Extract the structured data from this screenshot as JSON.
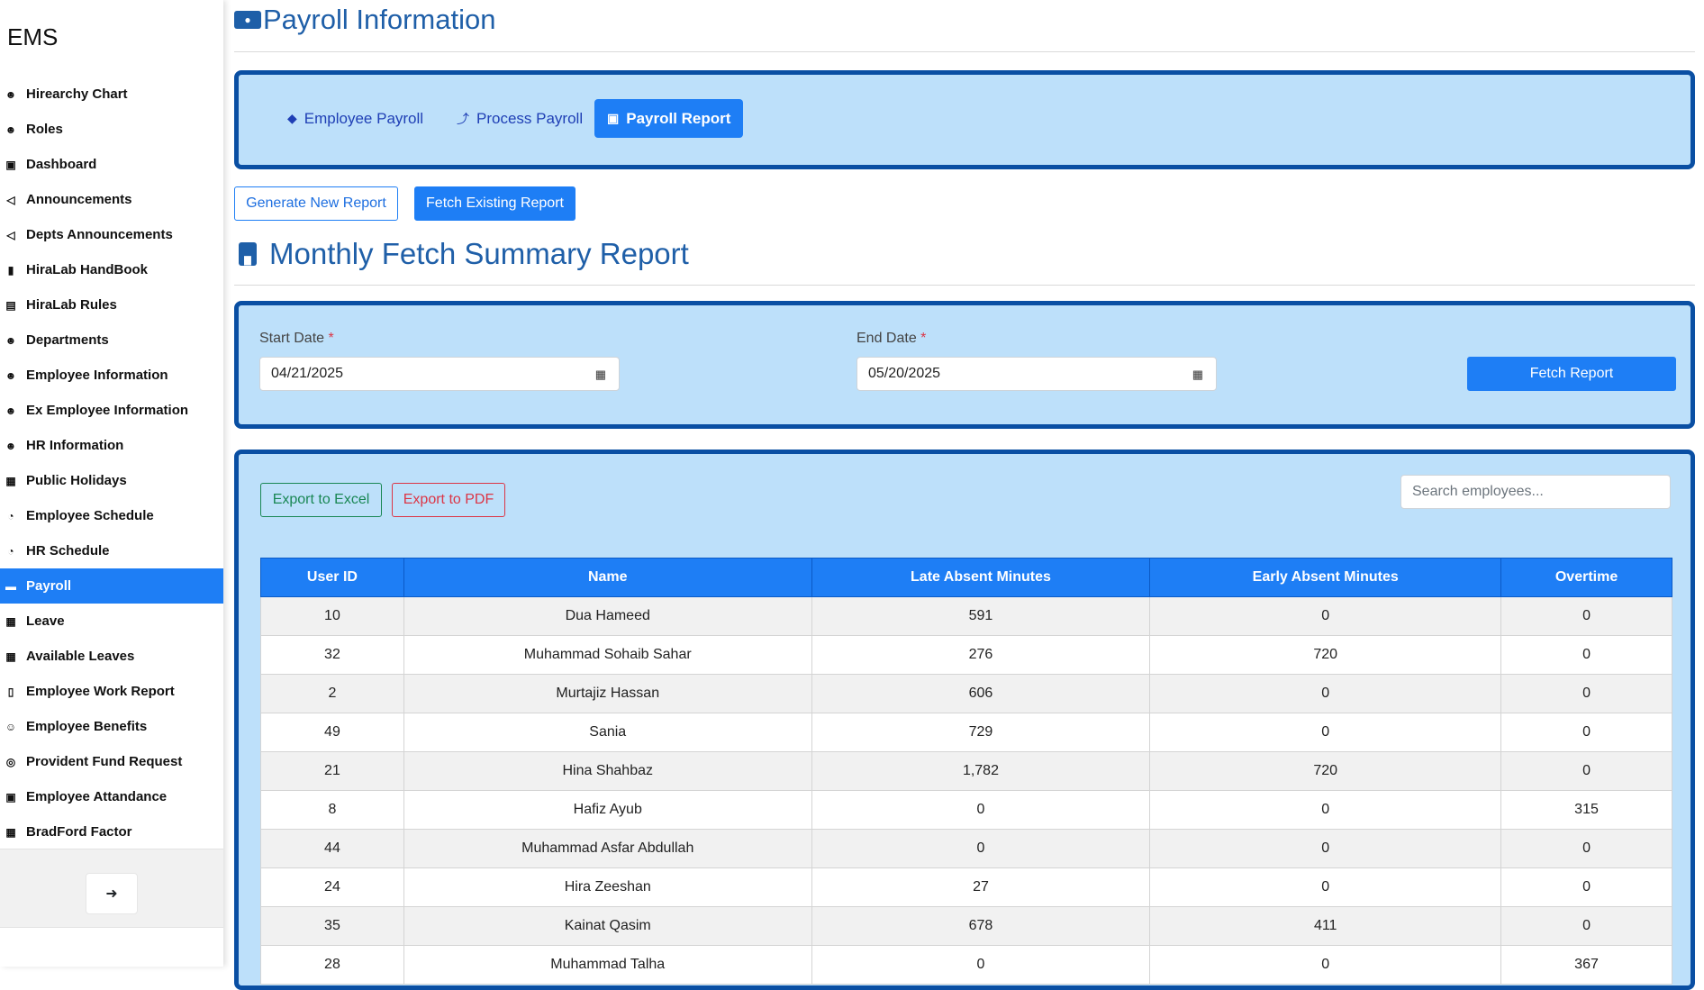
{
  "app": {
    "brand": "EMS"
  },
  "sidebar": {
    "items": [
      {
        "label": "Hirearchy Chart",
        "icon": "users-icon"
      },
      {
        "label": "Roles",
        "icon": "users-icon"
      },
      {
        "label": "Dashboard",
        "icon": "dashboard-icon"
      },
      {
        "label": "Announcements",
        "icon": "megaphone-icon"
      },
      {
        "label": "Depts Announcements",
        "icon": "megaphone-icon"
      },
      {
        "label": "HiraLab HandBook",
        "icon": "book-icon"
      },
      {
        "label": "HiraLab Rules",
        "icon": "rules-icon"
      },
      {
        "label": "Departments",
        "icon": "users-icon"
      },
      {
        "label": "Employee Information",
        "icon": "users-icon"
      },
      {
        "label": "Ex Employee Information",
        "icon": "users-icon"
      },
      {
        "label": "HR Information",
        "icon": "users-icon"
      },
      {
        "label": "Public Holidays",
        "icon": "calendar-icon"
      },
      {
        "label": "Employee Schedule",
        "icon": "clock-icon"
      },
      {
        "label": "HR Schedule",
        "icon": "clock-icon"
      },
      {
        "label": "Payroll",
        "icon": "money-icon"
      },
      {
        "label": "Leave",
        "icon": "calendar-icon"
      },
      {
        "label": "Available Leaves",
        "icon": "calendar-icon"
      },
      {
        "label": "Employee Work Report",
        "icon": "file-icon"
      },
      {
        "label": "Employee Benefits",
        "icon": "smile-icon"
      },
      {
        "label": "Provident Fund Request",
        "icon": "fund-icon"
      },
      {
        "label": "Employee Attandance",
        "icon": "id-card-icon"
      },
      {
        "label": "BradFord Factor",
        "icon": "calendar-icon"
      }
    ],
    "active": "Payroll"
  },
  "header": {
    "title": "Payroll Information"
  },
  "tabs": {
    "employee_payroll": "Employee Payroll",
    "process_payroll": "Process Payroll",
    "payroll_report": "Payroll Report"
  },
  "actions": {
    "generate": "Generate New Report",
    "fetch_existing": "Fetch Existing Report"
  },
  "section": {
    "title": "Monthly Fetch Summary Report"
  },
  "filters": {
    "start_label": "Start Date",
    "start_value": "04/21/2025",
    "end_label": "End Date",
    "end_value": "05/20/2025",
    "required_mark": "*",
    "fetch_button": "Fetch Report"
  },
  "export": {
    "excel": "Export to Excel",
    "pdf": "Export to PDF"
  },
  "search": {
    "placeholder": "Search employees..."
  },
  "table": {
    "headers": [
      "User ID",
      "Name",
      "Late Absent Minutes",
      "Early Absent Minutes",
      "Overtime"
    ],
    "rows": [
      [
        "10",
        "Dua Hameed",
        "591",
        "0",
        "0"
      ],
      [
        "32",
        "Muhammad Sohaib Sahar",
        "276",
        "720",
        "0"
      ],
      [
        "2",
        "Murtajiz Hassan",
        "606",
        "0",
        "0"
      ],
      [
        "49",
        "Sania",
        "729",
        "0",
        "0"
      ],
      [
        "21",
        "Hina Shahbaz",
        "1,782",
        "720",
        "0"
      ],
      [
        "8",
        "Hafiz Ayub",
        "0",
        "0",
        "315"
      ],
      [
        "44",
        "Muhammad Asfar Abdullah",
        "0",
        "0",
        "0"
      ],
      [
        "24",
        "Hira Zeeshan",
        "27",
        "0",
        "0"
      ],
      [
        "35",
        "Kainat Qasim",
        "678",
        "411",
        "0"
      ],
      [
        "28",
        "Muhammad Talha",
        "0",
        "0",
        "367"
      ]
    ]
  },
  "colors": {
    "accent": "#1e7ef5",
    "panel_bg": "#bde0fa",
    "panel_border": "#0a4fa3",
    "title": "#1f5fa8",
    "excel": "#198754",
    "pdf": "#dc3545"
  }
}
